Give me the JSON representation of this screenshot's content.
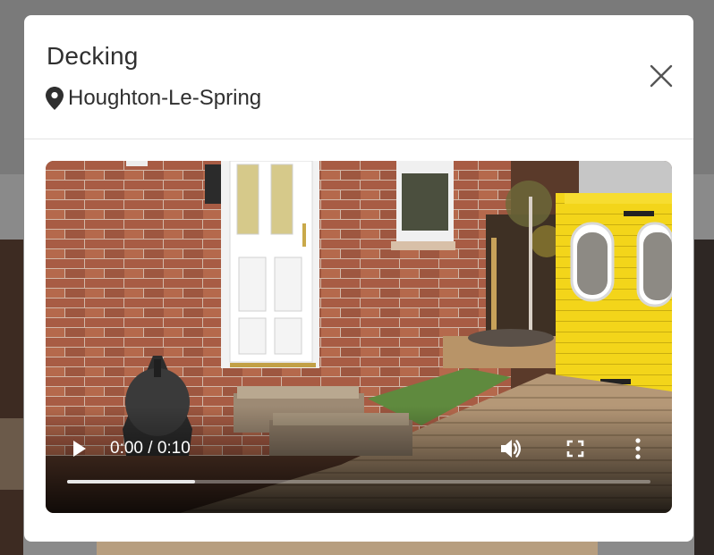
{
  "modal": {
    "title": "Decking",
    "location": "Houghton-Le-Spring",
    "icons": {
      "location": "map-pin-icon",
      "close": "close-icon"
    }
  },
  "video": {
    "current_time": "0:00",
    "duration": "0:10",
    "time_display": "0:00 / 0:10",
    "progress_buffered": 0.22,
    "icons": {
      "play": "play-icon",
      "volume": "volume-icon",
      "fullscreen": "fullscreen-icon",
      "more": "more-vertical-icon"
    }
  }
}
